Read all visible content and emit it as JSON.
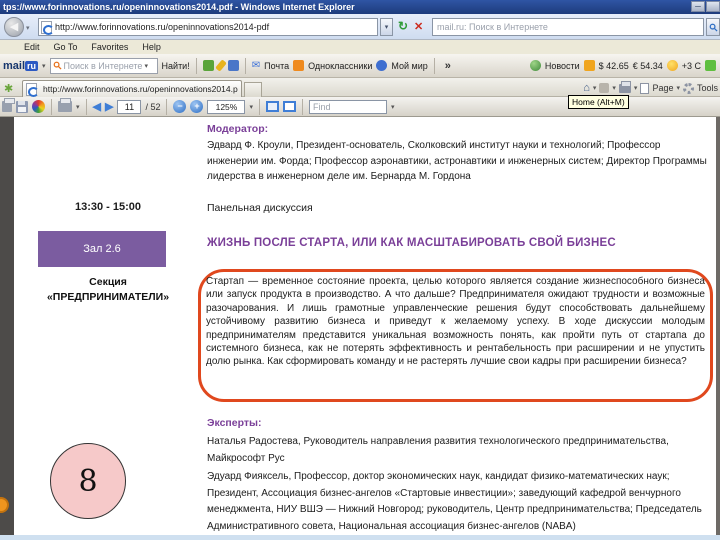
{
  "window": {
    "title": "tps://www.forinnovations.ru/openinnovations2014.pdf - Windows Internet Explorer"
  },
  "icons": {
    "back": "◀",
    "dropdown": "▾",
    "refresh": "↻",
    "stop": "✕",
    "home": "⌂",
    "mail": "✉",
    "chevron": "»",
    "star": "✱",
    "arrow_left": "◀",
    "arrow_right": "▶",
    "zoom_out": "−",
    "zoom_in": "+",
    "minimize": "─"
  },
  "address_bar": {
    "url": "http://www.forinnovations.ru/openinnovations2014-pdf",
    "search_placeholder": "mail.ru: Поиск в Интернете"
  },
  "menu": {
    "items": [
      "Edit",
      "Go To",
      "Favorites",
      "Help"
    ]
  },
  "mailru_toolbar": {
    "logo_main": "mail",
    "logo_ru": "ru",
    "search_placeholder": "Поиск в Интернете",
    "find_button": "Найти!",
    "mail_label": "Почта",
    "ok_label": "Одноклассники",
    "moimir_label": "Мой мир",
    "news_label": "Новости",
    "usd": "$ 42.65",
    "eur": "€ 54.34",
    "weather": "+3 C"
  },
  "tab_bar": {
    "tab_title": "http://www.forinnovations.ru/openinnovations2014.pdf",
    "page_label": "Page",
    "tools_label": "Tools"
  },
  "tooltip": "Home (Alt+M)",
  "pdf_toolbar": {
    "page_current": "11",
    "page_total": "/ 52",
    "zoom_level": "125%",
    "find_placeholder": "Find"
  },
  "document": {
    "moderator_label": "Модератор:",
    "moderator_text": "Эдвард Ф. Кроули, Президент-основатель, Сколковский институт науки и технологий; Профессор инженерии им. Форда; Профессор аэронавтики, астронавтики и инженерных систем; Директор Программы лидерства в инженерном деле им. Бернарда М. Гордона",
    "time": "13:30 - 15:00",
    "session_type": "Панельная дискуссия",
    "room": "Зал 2.6",
    "title": "ЖИЗНЬ ПОСЛЕ СТАРТА, ИЛИ КАК МАСШТАБИРОВАТЬ СВОЙ БИЗНЕС",
    "section_line1": "Секция",
    "section_line2": "«ПРЕДПРИНИМАТЕЛИ»",
    "abstract": "Стартап — временное состояние проекта, целью которого является создание жизнеспособного бизнеса или запуск продукта в производство. А что дальше? Предпринимателя ожидают трудности и возможные разочарования. И лишь грамотные управленческие решения будут способствовать дальнейшему устойчивому развитию бизнеса и приведут к желаемому успеху. В ходе дискуссии молодым предпринимателям представится уникальная возможность понять, как пройти путь от стартапа до системного бизнеса, как не потерять эффективность и рентабельность при расширении и не упустить долю рынка. Как сформировать команду и не растерять лучшие свои кадры при расширении бизнеса?",
    "experts_label": "Эксперты:",
    "experts": [
      "Наталья Радостева, Руководитель направления развития технологического предпринимательства, Майкрософт Рус",
      "Эдуард Фияксель, Профессор, доктор экономических наук, кандидат физико-математических наук; Президент, Ассоциация бизнес-ангелов «Стартовые инвестиции»; заведующий кафедрой венчурного менеджмента, НИУ ВШЭ — Нижний Новгород; руководитель, Центр предпринимательства; Председатель Административного совета, Национальная ассоциация бизнес-ангелов (NABA)"
    ],
    "page_badge": "8"
  },
  "colors": {
    "accent_purple": "#7a3f98",
    "room_fill": "#7b5ca0",
    "highlight_oval": "#e0481e",
    "badge_fill": "#f6c9c9",
    "titlebar_blue": "#1d3b7c"
  }
}
